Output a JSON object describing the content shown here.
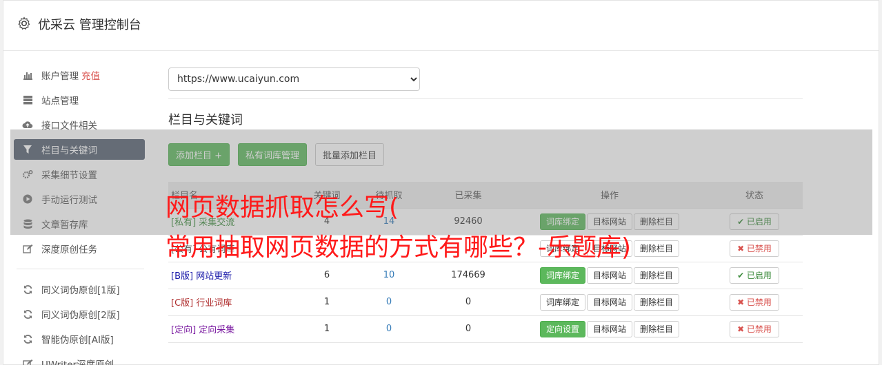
{
  "app": {
    "title": "优采云 管理控制台",
    "icon": "gear-icon"
  },
  "sidebar": {
    "items": [
      {
        "label": "账户管理",
        "extra": "充值",
        "icon": "bar-chart-icon",
        "active": false
      },
      {
        "label": "站点管理",
        "icon": "server-icon",
        "active": false
      },
      {
        "label": "接口文件相关",
        "icon": "cloud-upload-icon",
        "active": false
      },
      {
        "label": "栏目与关键词",
        "icon": "filter-icon",
        "active": true
      },
      {
        "label": "采集细节设置",
        "icon": "cogs-icon",
        "active": false
      },
      {
        "label": "手动运行测试",
        "icon": "play-circle-icon",
        "active": false
      },
      {
        "label": "文章暂存库",
        "icon": "database-icon",
        "active": false
      },
      {
        "label": "深度原创任务",
        "icon": "edit-icon",
        "active": false
      }
    ],
    "items2": [
      {
        "label": "同义词伪原创[1版]",
        "icon": "refresh-icon"
      },
      {
        "label": "同义词伪原创[2版]",
        "icon": "refresh-icon"
      },
      {
        "label": "智能伪原创[AI版]",
        "icon": "refresh-icon"
      },
      {
        "label": "UWriter深度原创",
        "icon": "edit-icon"
      }
    ]
  },
  "main": {
    "site_select": "https://www.ucaiyun.com",
    "section_title": "栏目与关键词",
    "buttons": {
      "add": "添加栏目 +",
      "private_lib": "私有词库管理",
      "batch_add": "批量添加栏目"
    }
  },
  "table": {
    "headers": [
      "栏目名",
      "关键词",
      "待抓取",
      "已采集",
      "操作",
      "状态"
    ],
    "rows": [
      {
        "tag": "[私有]",
        "name": "采集交流",
        "tag_color": "#3c8b3c",
        "kw": "4",
        "pending": "14",
        "collected": "92460",
        "action1": "词库绑定",
        "action1_green": true,
        "action2": "目标网站",
        "action3": "删除栏目",
        "status": "✔ 已启用",
        "status_on": true
      },
      {
        "tag": "[公有]",
        "name": "公有词库",
        "tag_color": "#555555",
        "kw": "",
        "pending": "",
        "collected": "",
        "action1": "词库绑定",
        "action1_green": false,
        "action2": "目标网站",
        "action3": "删除栏目",
        "status": "✖ 已禁用",
        "status_on": false
      },
      {
        "tag": "[B版]",
        "name": "网站更新",
        "tag_color": "#1a1aaa",
        "kw": "6",
        "pending": "10",
        "collected": "174669",
        "action1": "词库绑定",
        "action1_green": true,
        "action2": "目标网站",
        "action3": "删除栏目",
        "status": "✔ 已启用",
        "status_on": true
      },
      {
        "tag": "[C版]",
        "name": "行业词库",
        "tag_color": "#b03030",
        "kw": "1",
        "pending": "0",
        "collected": "0",
        "action1": "词库绑定",
        "action1_green": false,
        "action2": "目标网站",
        "action3": "删除栏目",
        "status": "✖ 已禁用",
        "status_on": false
      },
      {
        "tag": "[定向]",
        "name": "定向采集",
        "tag_color": "#7a1aa0",
        "kw": "1",
        "pending": "0",
        "collected": "0",
        "action1": "定向设置",
        "action1_green": true,
        "action2": "目标网站",
        "action3": "删除栏目",
        "status": "✖ 已禁用",
        "status_on": false
      }
    ]
  },
  "watermark": {
    "line1": "网页数据抓取怎么写(",
    "line2": "常用抽取网页数据的方式有哪些？-乐题库)"
  }
}
